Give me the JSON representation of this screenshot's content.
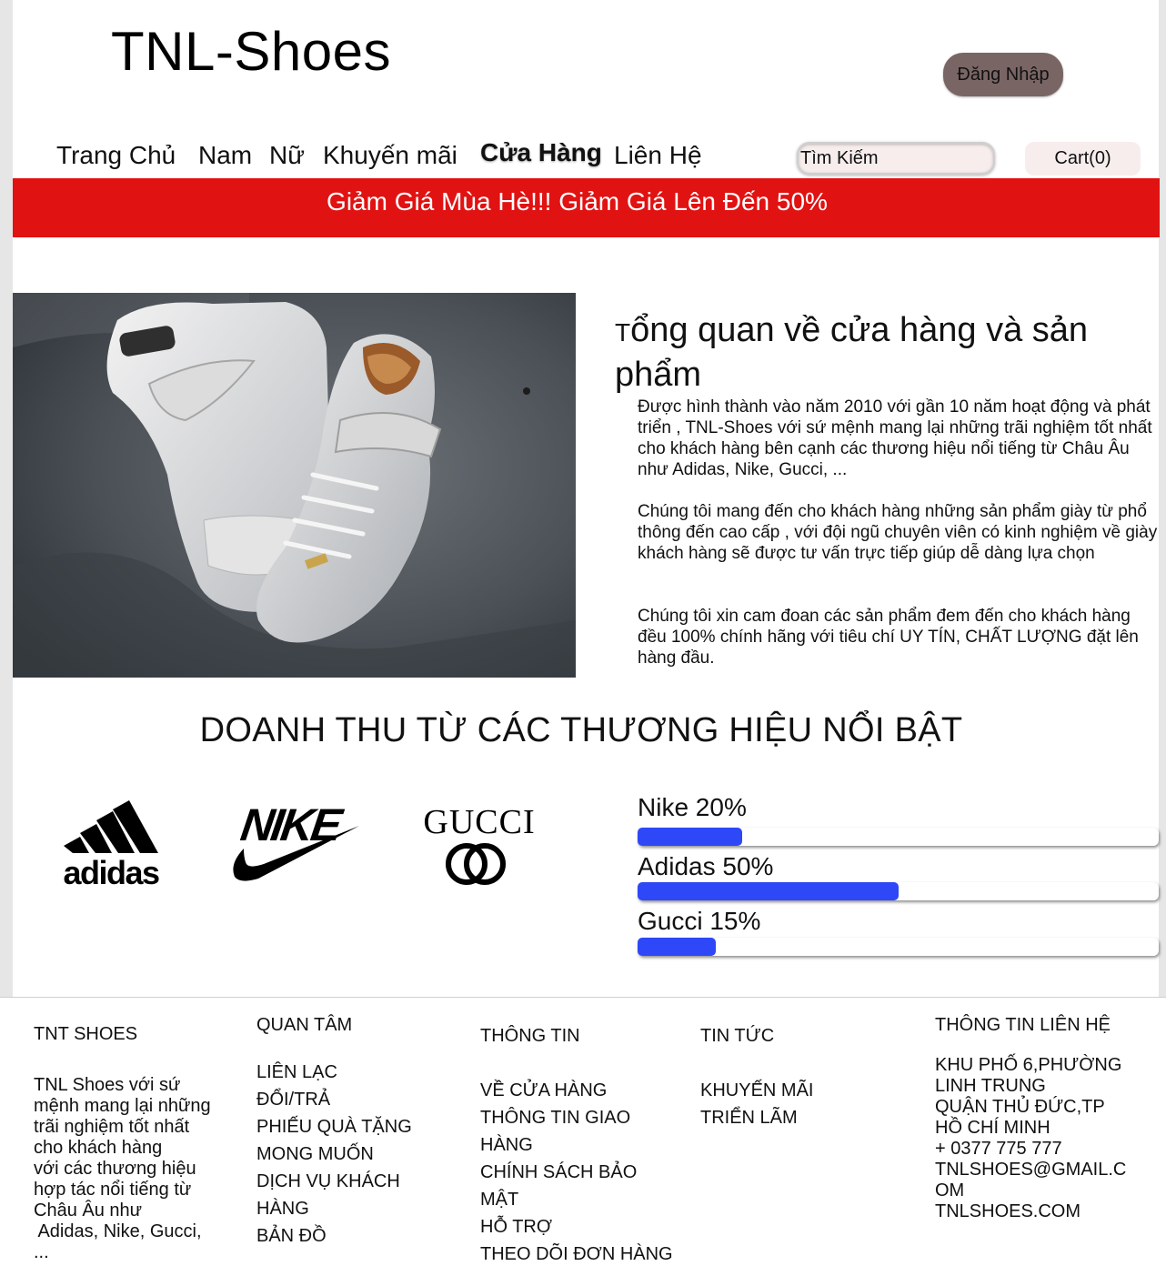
{
  "header": {
    "logo": "TNL-Shoes",
    "login_label": "Đăng Nhập",
    "nav": [
      {
        "label": "Trang Chủ"
      },
      {
        "label": "Nam"
      },
      {
        "label": "Nữ"
      },
      {
        "label": "Khuyến mãi"
      },
      {
        "label": "Cửa Hàng",
        "active": true
      },
      {
        "label": "Liên Hệ"
      }
    ],
    "search_placeholder": "Tìm Kiếm",
    "cart_label": "Cart(0)"
  },
  "promo": {
    "text": "Giảm Giá Mùa Hè!!! Giảm Giá Lên Đến 50%"
  },
  "about": {
    "title_first_letter": "T",
    "title_rest_line1": "ổng quan về cửa hàng và sản",
    "title_line2": "phẩm",
    "paragraphs": [
      "Được hình thành vào năm 2010 với gần 10 năm hoạt động và phát triển , TNL-Shoes với sứ mệnh mang lại những trãi nghiệm tốt nhất cho khách hàng bên cạnh các thương hiệu nổi tiếng từ Châu Âu như Adidas, Nike, Gucci, ...",
      "Chúng tôi mang đến cho khách hàng những sản phẩm giày từ phổ thông đến cao cấp , với đội ngũ chuyên viên có kinh nghiệm về giày khách hàng sẽ được tư vấn trực tiếp giúp dễ dàng lựa chọn",
      "Chúng tôi xin cam đoan các sản phẩm đem đến cho khách hàng đều 100% chính hãng với tiêu chí UY TÍN, CHẤT LƯỢNG đặt lên hàng đầu."
    ]
  },
  "revenue": {
    "title": "DOANH THU TỪ CÁC THƯƠNG HIỆU NỔI BẬT",
    "brands": {
      "adidas": "adidas",
      "nike": "NIKE",
      "gucci": "GUCCI"
    },
    "bars": [
      {
        "label": "Nike 20%",
        "percent": 20
      },
      {
        "label": "Adidas 50%",
        "percent": 50
      },
      {
        "label": "Gucci 15%",
        "percent": 15
      }
    ],
    "bar_color": "#2e48f7"
  },
  "footer": {
    "col1": {
      "title": "TNT SHOES",
      "text": [
        "TNL Shoes với sứ",
        "mệnh mang lại những",
        "trãi nghiệm tốt nhất",
        "cho khách hàng",
        "với các thương hiệu",
        "hợp tác nổi tiếng từ",
        "Châu Âu như",
        " Adidas, Nike, Gucci,",
        "..."
      ]
    },
    "col2": {
      "title": "QUAN TÂM",
      "items": [
        "LIÊN LẠC",
        "ĐỔI/TRẢ",
        "PHIẾU QUÀ TẶNG",
        "MONG MUỐN",
        "DỊCH VỤ KHÁCH",
        "HÀNG",
        "BẢN ĐỒ"
      ]
    },
    "col3": {
      "title": "THÔNG TIN",
      "items": [
        "VỀ CỬA HÀNG",
        "THÔNG TIN GIAO",
        "HÀNG",
        "CHÍNH SÁCH BẢO",
        "MẬT",
        "HỖ TRỢ",
        "THEO DÕI ĐƠN HÀNG"
      ]
    },
    "col4": {
      "title": "TIN TỨC",
      "items": [
        "KHUYẾN MÃI",
        "TRIỂN LÃM"
      ]
    },
    "col5": {
      "title": "THÔNG TIN LIÊN HỆ",
      "lines": [
        "KHU PHỐ 6,PHƯỜNG",
        "LINH TRUNG",
        "QUẬN THỦ ĐỨC,TP",
        "HỒ CHÍ MINH",
        "+ 0377 775 777",
        "TNLSHOES@GMAIL.C",
        "OM",
        "TNLSHOES.COM"
      ]
    }
  },
  "colors": {
    "promo_bg": "#e11212",
    "login_bg": "#7a6565",
    "bar": "#2e48f7"
  }
}
